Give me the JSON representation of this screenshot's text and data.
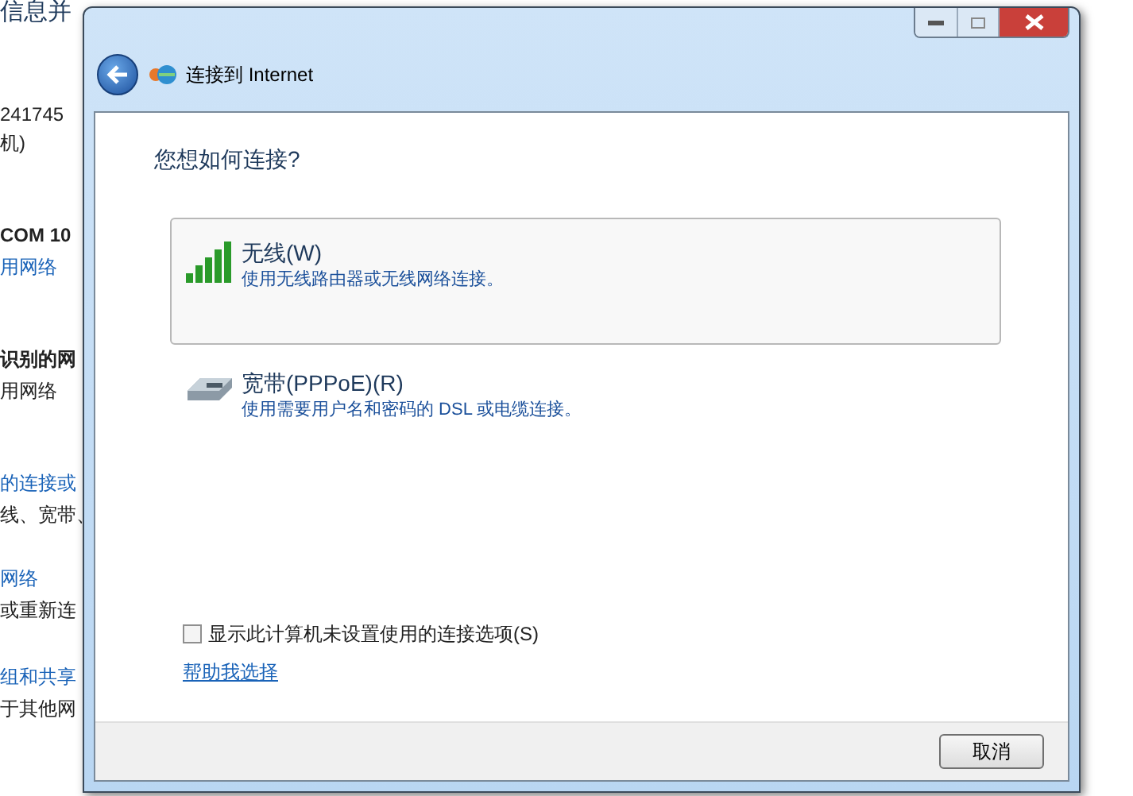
{
  "background_page": {
    "lines": [
      {
        "text": "信息并",
        "kind": "heading"
      },
      {
        "text": "241745",
        "kind": "plain"
      },
      {
        "text": "机)",
        "kind": "plain"
      },
      {
        "text": "COM 10",
        "kind": "bold"
      },
      {
        "text": "用网络",
        "kind": "link"
      },
      {
        "text": "识别的网",
        "kind": "bold"
      },
      {
        "text": "用网络",
        "kind": "plain"
      },
      {
        "text": "的连接或",
        "kind": "link"
      },
      {
        "text": "线、宽带、",
        "kind": "plain"
      },
      {
        "text": "网络",
        "kind": "link"
      },
      {
        "text": "或重新连",
        "kind": "plain"
      },
      {
        "text": "组和共享",
        "kind": "link"
      },
      {
        "text": "于其他网",
        "kind": "plain"
      }
    ]
  },
  "window": {
    "title": "连接到 Internet"
  },
  "heading": "您想如何连接?",
  "options": [
    {
      "kind": "wireless",
      "title": "无线(W)",
      "description": "使用无线路由器或无线网络连接。",
      "selected": true
    },
    {
      "kind": "broadband",
      "title": "宽带(PPPoE)(R)",
      "description": "使用需要用户名和密码的 DSL 或电缆连接。",
      "selected": false
    }
  ],
  "show_unconfigured": {
    "label": "显示此计算机未设置使用的连接选项(S)",
    "checked": false
  },
  "help_link": "帮助我选择",
  "buttons": [
    "取消"
  ]
}
